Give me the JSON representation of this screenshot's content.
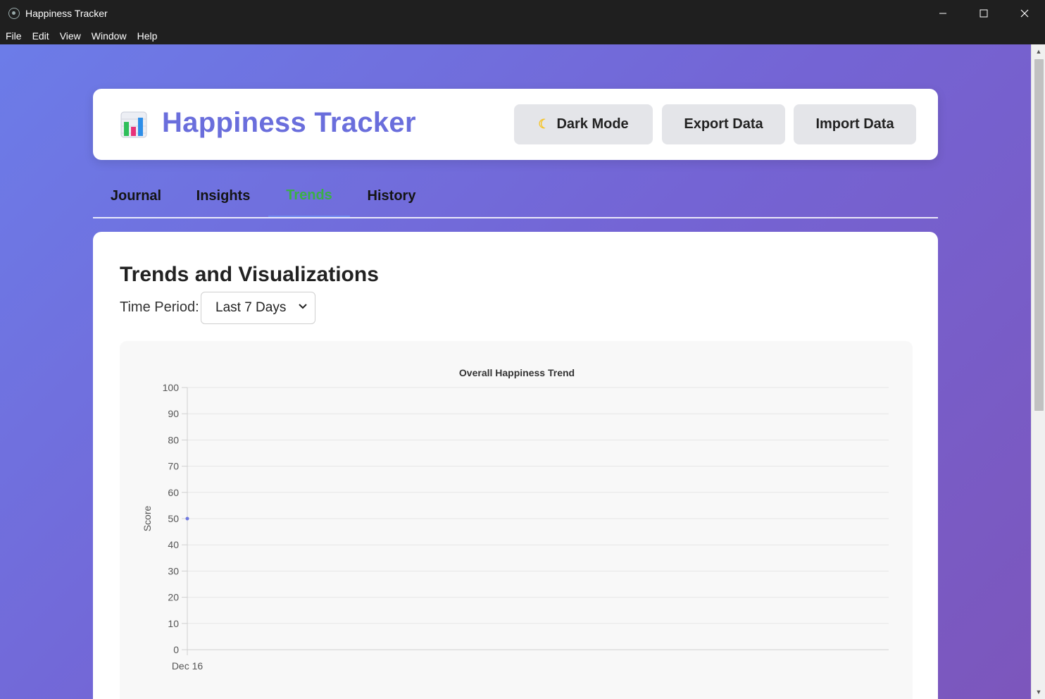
{
  "window": {
    "title": "Happiness Tracker"
  },
  "menu": [
    "File",
    "Edit",
    "View",
    "Window",
    "Help"
  ],
  "header": {
    "title": "Happiness Tracker",
    "logo_icon": "bar-chart-icon",
    "buttons": {
      "dark_mode": "Dark Mode",
      "export": "Export Data",
      "import": "Import Data"
    }
  },
  "tabs": [
    {
      "label": "Journal",
      "active": false
    },
    {
      "label": "Insights",
      "active": false
    },
    {
      "label": "Trends",
      "active": true
    },
    {
      "label": "History",
      "active": false
    }
  ],
  "trends": {
    "title": "Trends and Visualizations",
    "period_label": "Time Period:",
    "period_value": "Last 7 Days"
  },
  "colors": {
    "accent": "#6a6edc",
    "active_tab": "#3ab046",
    "point": "#6f78e0"
  },
  "chart_data": {
    "type": "line",
    "title": "Overall Happiness Trend",
    "xlabel": "",
    "ylabel": "Score",
    "ylim": [
      0,
      100
    ],
    "yticks": [
      0,
      10,
      20,
      30,
      40,
      50,
      60,
      70,
      80,
      90,
      100
    ],
    "categories": [
      "Dec 16"
    ],
    "series": [
      {
        "values": [
          50
        ]
      }
    ],
    "grid": true,
    "legend": "none"
  }
}
